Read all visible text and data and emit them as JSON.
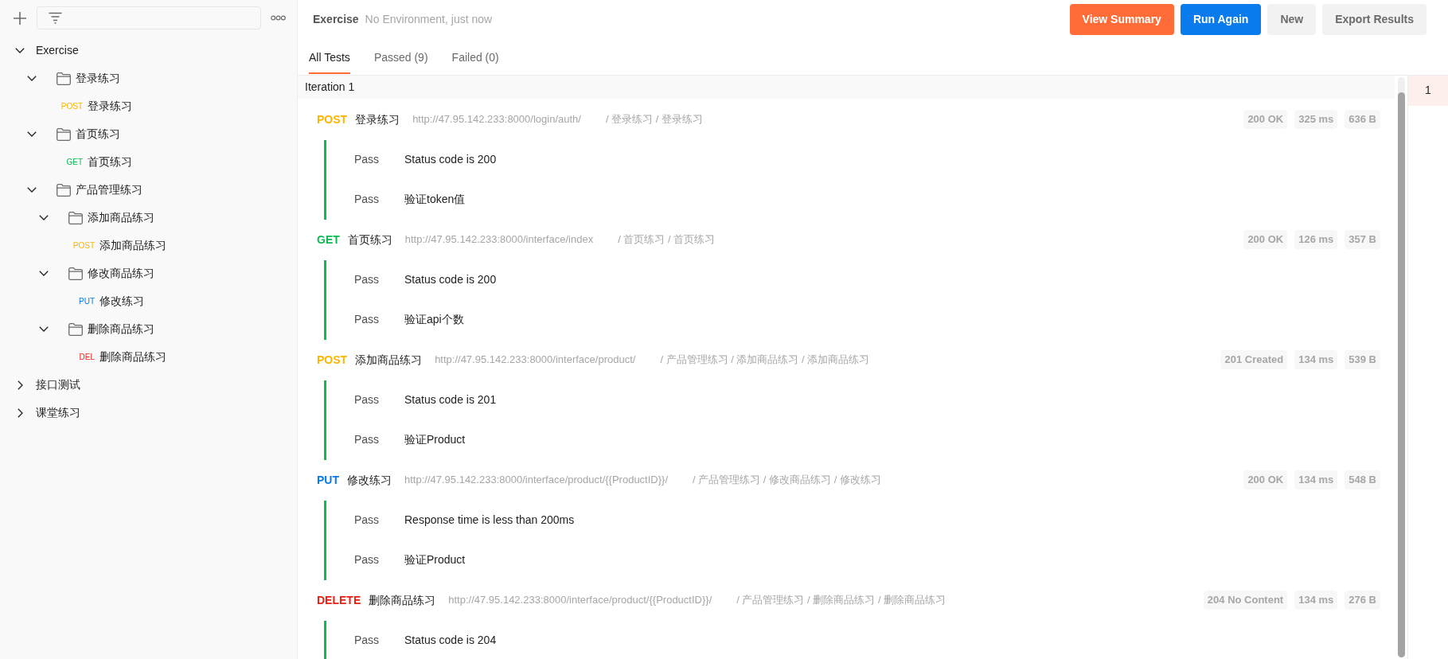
{
  "sidebar": {
    "tree": [
      {
        "kind": "collection",
        "label": "Exercise",
        "expanded": true,
        "children": [
          {
            "kind": "folder",
            "label": "登录练习",
            "expanded": true,
            "children": [
              {
                "kind": "request",
                "method": "POST",
                "color": "#ffb400",
                "label": "登录练习"
              }
            ]
          },
          {
            "kind": "folder",
            "label": "首页练习",
            "expanded": true,
            "children": [
              {
                "kind": "request",
                "method": "GET",
                "color": "#0cbb52",
                "label": "首页练习"
              }
            ]
          },
          {
            "kind": "folder",
            "label": "产品管理练习",
            "expanded": true,
            "children": [
              {
                "kind": "folder",
                "label": "添加商品练习",
                "expanded": true,
                "children": [
                  {
                    "kind": "request",
                    "method": "POST",
                    "color": "#ffb400",
                    "label": "添加商品练习"
                  }
                ]
              },
              {
                "kind": "folder",
                "label": "修改商品练习",
                "expanded": true,
                "children": [
                  {
                    "kind": "request",
                    "method": "PUT",
                    "color": "#097bed",
                    "label": "修改练习"
                  }
                ]
              },
              {
                "kind": "folder",
                "label": "删除商品练习",
                "expanded": true,
                "children": [
                  {
                    "kind": "request",
                    "method": "DEL",
                    "color": "#eb2013",
                    "label": "删除商品练习"
                  }
                ]
              }
            ]
          }
        ]
      },
      {
        "kind": "collection",
        "label": "接口测试",
        "expanded": false
      },
      {
        "kind": "collection",
        "label": "课堂练习",
        "expanded": false
      }
    ]
  },
  "run": {
    "collection": "Exercise",
    "meta": "No Environment, just now"
  },
  "buttons": [
    {
      "label": "View Summary",
      "kind": "primary"
    },
    {
      "label": "Run Again",
      "kind": "accent"
    },
    {
      "label": "New",
      "kind": "plain"
    },
    {
      "label": "Export Results",
      "kind": "plain"
    }
  ],
  "tabs": [
    {
      "label": "All Tests",
      "selected": true
    },
    {
      "label": "Passed (9)",
      "selected": false
    },
    {
      "label": "Failed (0)",
      "selected": false
    }
  ],
  "iteration": {
    "title": "Iteration 1"
  },
  "results": [
    {
      "method": "POST",
      "color": "#ffb400",
      "name": "登录练习",
      "url": "http://47.95.142.233:8000/login/auth/",
      "path": "/ 登录练习 / 登录练习",
      "status": "200 OK",
      "time": "325 ms",
      "size": "636 B",
      "passed": true,
      "tests": [
        {
          "result": "Pass",
          "name": "Status code is 200"
        },
        {
          "result": "Pass",
          "name": "验证token值"
        }
      ]
    },
    {
      "method": "GET",
      "color": "#0cbb52",
      "name": "首页练习",
      "url": "http://47.95.142.233:8000/interface/index",
      "path": "/ 首页练习 / 首页练习",
      "status": "200 OK",
      "time": "126 ms",
      "size": "357 B",
      "passed": true,
      "tests": [
        {
          "result": "Pass",
          "name": "Status code is 200"
        },
        {
          "result": "Pass",
          "name": "验证api个数"
        }
      ]
    },
    {
      "method": "POST",
      "color": "#ffb400",
      "name": "添加商品练习",
      "url": "http://47.95.142.233:8000/interface/product/",
      "path": "/ 产品管理练习 / 添加商品练习 / 添加商品练习",
      "status": "201 Created",
      "time": "134 ms",
      "size": "539 B",
      "passed": true,
      "tests": [
        {
          "result": "Pass",
          "name": "Status code is 201"
        },
        {
          "result": "Pass",
          "name": "验证Product"
        }
      ]
    },
    {
      "method": "PUT",
      "color": "#097bed",
      "name": "修改练习",
      "url": "http://47.95.142.233:8000/interface/product/{{ProductID}}/",
      "path": "/ 产品管理练习 / 修改商品练习 / 修改练习",
      "status": "200 OK",
      "time": "134 ms",
      "size": "548 B",
      "passed": true,
      "tests": [
        {
          "result": "Pass",
          "name": "Response time is less than 200ms"
        },
        {
          "result": "Pass",
          "name": "验证Product"
        }
      ]
    },
    {
      "method": "DELETE",
      "color": "#eb2013",
      "name": "删除商品练习",
      "url": "http://47.95.142.233:8000/interface/product/{{ProductID}}/",
      "path": "/ 产品管理练习 / 删除商品练习 / 删除商品练习",
      "status": "204 No Content",
      "time": "134 ms",
      "size": "276 B",
      "passed": true,
      "tests": [
        {
          "result": "Pass",
          "name": "Status code is 204"
        }
      ]
    }
  ],
  "iterations": [
    {
      "label": "1",
      "selected": true
    }
  ]
}
